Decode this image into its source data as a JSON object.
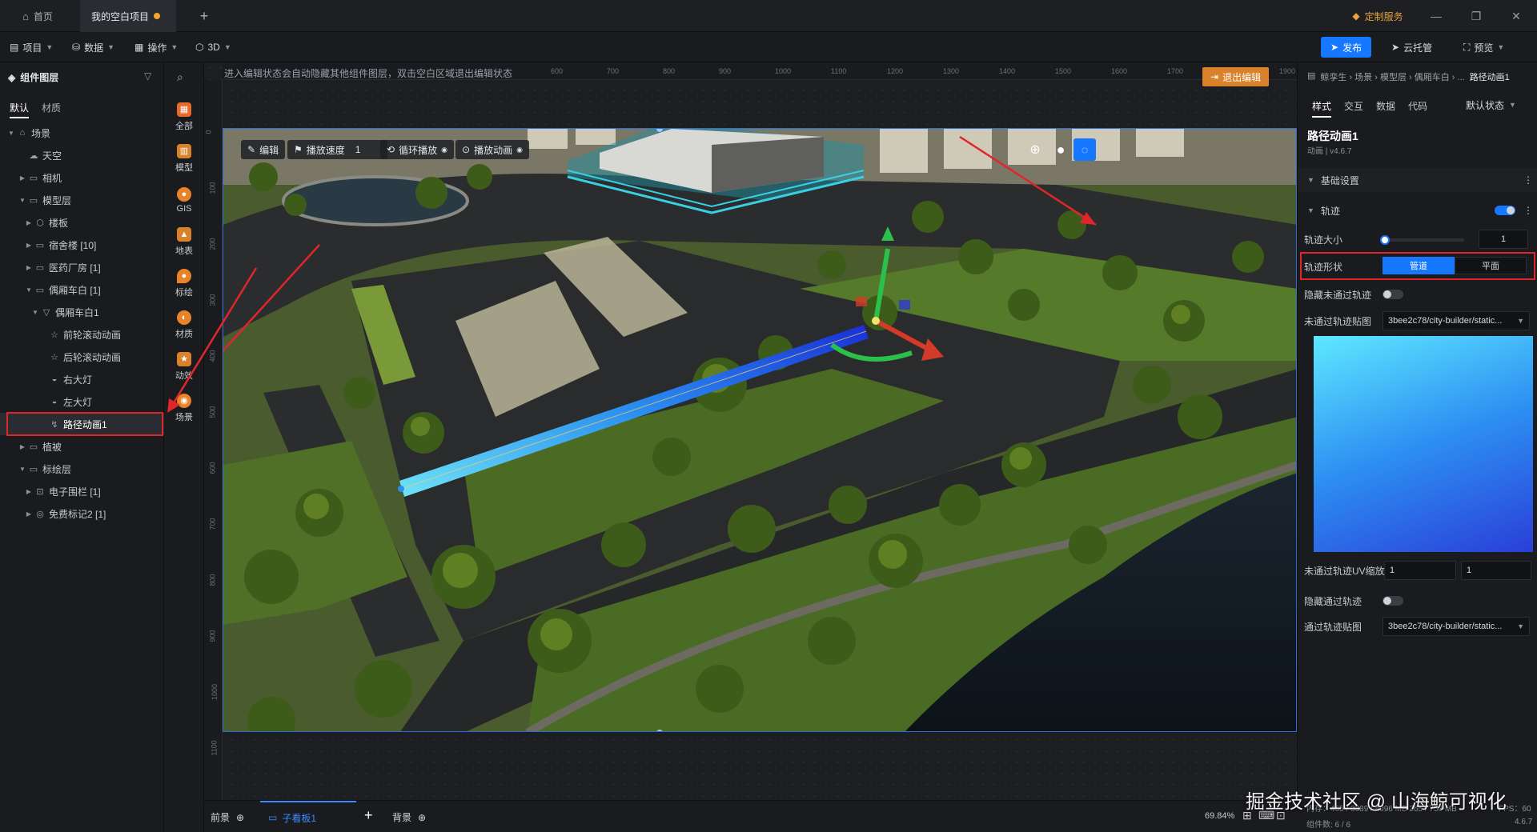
{
  "titlebar": {
    "tabs": [
      {
        "label": "首页"
      },
      {
        "label": "我的空白项目"
      }
    ],
    "add_tab": "+",
    "service_label": "定制服务",
    "win_min": "—",
    "win_max": "❐",
    "win_close": "✕"
  },
  "menubar": {
    "items": [
      {
        "label": "项目"
      },
      {
        "label": "数据"
      },
      {
        "label": "操作"
      },
      {
        "label": "3D"
      }
    ],
    "publish": "发布",
    "cloud": "云托管",
    "preview": "预览"
  },
  "left_panel": {
    "title": "组件图层",
    "tabs": [
      {
        "label": "默认"
      },
      {
        "label": "材质"
      }
    ],
    "tree": [
      {
        "label": "场景"
      },
      {
        "label": "天空"
      },
      {
        "label": "相机"
      },
      {
        "label": "模型层"
      },
      {
        "label": "楼板"
      },
      {
        "label": "宿舍楼 [10]"
      },
      {
        "label": "医药厂房 [1]"
      },
      {
        "label": "偶厢车白 [1]"
      },
      {
        "label": "偶厢车白1"
      },
      {
        "label": "前轮滚动动画"
      },
      {
        "label": "后轮滚动动画"
      },
      {
        "label": "右大灯"
      },
      {
        "label": "左大灯"
      },
      {
        "label": "路径动画1"
      },
      {
        "label": "植被"
      },
      {
        "label": "标绘层"
      },
      {
        "label": "电子围栏 [1]"
      },
      {
        "label": "免费标记2 [1]"
      }
    ]
  },
  "icon_column": [
    {
      "label": "全部"
    },
    {
      "label": "模型"
    },
    {
      "label": "GIS"
    },
    {
      "label": "地表"
    },
    {
      "label": "标绘"
    },
    {
      "label": "材质"
    },
    {
      "label": "动效"
    },
    {
      "label": "场景"
    }
  ],
  "canvas": {
    "hint": "进入编辑状态会自动隐藏其他组件图层，双击空白区域退出编辑状态",
    "exit_edit": "退出编辑",
    "ruler_h": [
      "600",
      "700",
      "800",
      "900",
      "1000",
      "1100",
      "1200",
      "1300",
      "1400",
      "1500",
      "1600",
      "1700",
      "1800",
      "1900"
    ],
    "ruler_v": [
      "0",
      "100",
      "200",
      "300",
      "400",
      "500",
      "600",
      "700",
      "800",
      "900",
      "1000",
      "1100",
      "00"
    ],
    "toolbar": {
      "edit": "编辑",
      "speed_label": "播放速度",
      "speed_value": "1",
      "loop": "循环播放",
      "play": "播放动画"
    }
  },
  "right_panel": {
    "breadcrumb": "鲸孪生 › 场景 › 模型层 › 偶厢车白 › ...",
    "breadcrumb_current": "路径动画1",
    "tabs": [
      {
        "label": "样式"
      },
      {
        "label": "交互"
      },
      {
        "label": "数据"
      },
      {
        "label": "代码"
      }
    ],
    "state_select": "默认状态",
    "comp_name": "路径动画1",
    "comp_meta": "动画 | v4.6.7",
    "section_basic": "基础设置",
    "section_track": "轨迹",
    "track_size_label": "轨迹大小",
    "track_size_value": "1",
    "track_shape_label": "轨迹形状",
    "shape_options": [
      "管道",
      "平面"
    ],
    "hide_unpassed_label": "隐藏未通过轨迹",
    "unpassed_tex_label": "未通过轨迹贴图",
    "unpassed_tex_value": "3bee2c78/city-builder/static...",
    "uv_label": "未通过轨迹UV缩放",
    "uv_x": "1",
    "uv_y": "1",
    "hide_passed_label": "隐藏通过轨迹",
    "passed_tex_label": "通过轨迹贴图",
    "passed_tex_value": "3bee2c78/city-builder/static..."
  },
  "bottom": {
    "foreground": "前景",
    "subboard": "子看板1",
    "add": "+",
    "background": "背景",
    "zoom": "69.84%",
    "stats_left": "内存：465 / 3389 / 4096 MB  265 / 750 MB",
    "fps": "FPS：60",
    "component_count": "组件数: 6 / 6",
    "version": "4.6.7"
  },
  "watermark": "掘金技术社区 @ 山海鲸可视化",
  "colors": {
    "accent": "#1677ff",
    "highlight": "#e0262b",
    "active_row": "#2a2c31"
  }
}
